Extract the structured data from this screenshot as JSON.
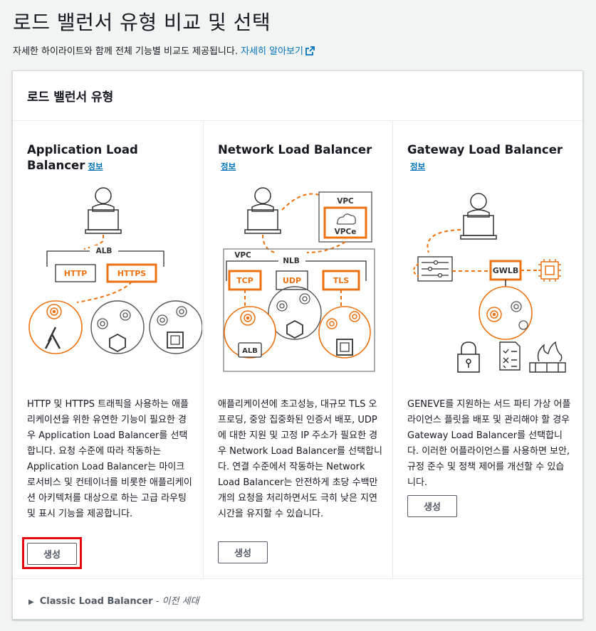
{
  "page": {
    "title": "로드 밸런서 유형 비교 및 선택",
    "description": "자세한 하이라이트와 함께 전체 기능별 비교도 제공됩니다.",
    "learn_more": "자세히 알아보기"
  },
  "card": {
    "title": "로드 밸런서 유형"
  },
  "columns": [
    {
      "title": "Application Load Balancer",
      "info": "정보",
      "description": "HTTP 및 HTTPS 트래픽을 사용하는 애플리케이션을 위한 유연한 기능이 필요한 경우 Application Load Balancer를 선택합니다. 요청 수준에 따라 작동하는 Application Load Balancer는 마이크로서비스 및 컨테이너를 비롯한 애플리케이션 아키텍처를 대상으로 하는 고급 라우팅 및 표시 기능을 제공합니다.",
      "button": "생성",
      "diagram": {
        "alb": "ALB",
        "http": "HTTP",
        "https": "HTTPS"
      }
    },
    {
      "title": "Network Load Balancer",
      "info": "정보",
      "description": "애플리케이션에 초고성능, 대규모 TLS 오프로딩, 중앙 집중화된 인증서 배포, UDP에 대한 지원 및 고정 IP 주소가 필요한 경우 Network Load Balancer를 선택합니다. 연결 수준에서 작동하는 Network Load Balancer는 안전하게 초당 수백만 개의 요청을 처리하면서도 극히 낮은 지연 시간을 유지할 수 있습니다.",
      "button": "생성",
      "diagram": {
        "vpc_outer": "VPC",
        "vpce": "VPCe",
        "vpc": "VPC",
        "nlb": "NLB",
        "tcp": "TCP",
        "udp": "UDP",
        "tls": "TLS",
        "alb": "ALB"
      }
    },
    {
      "title": "Gateway Load Balancer",
      "info": "정보",
      "description": "GENEVE를 지원하는 서드 파티 가상 어플라이언스 플릿을 배포 및 관리해야 할 경우 Gateway Load Balancer를 선택합니다. 이러한 어플라이언스를 사용하면 보안, 규정 준수 및 정책 제어를 개선할 수 있습니다.",
      "button": "생성",
      "diagram": {
        "gwlb": "GWLB"
      }
    }
  ],
  "classic": {
    "name": "Classic Load Balancer",
    "separator": " - ",
    "generation": "이전 세대"
  },
  "colors": {
    "accent_orange": "#ec7211",
    "link_blue": "#0073bb",
    "highlight_red": "#e8070f"
  }
}
